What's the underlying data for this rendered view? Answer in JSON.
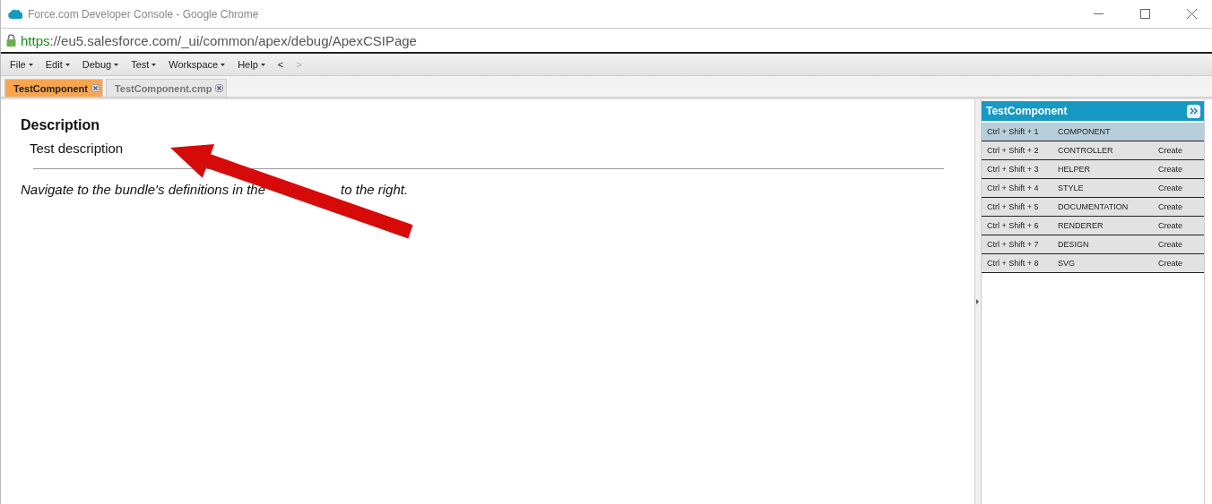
{
  "window": {
    "title": "Force.com Developer Console - Google Chrome"
  },
  "address_bar": {
    "url_scheme": "https",
    "url_rest": "://eu5.salesforce.com/_ui/common/apex/debug/ApexCSIPage"
  },
  "menu": [
    {
      "label": "File",
      "kind": "dropdown"
    },
    {
      "label": "Edit",
      "kind": "dropdown"
    },
    {
      "label": "Debug",
      "kind": "dropdown"
    },
    {
      "label": "Test",
      "kind": "dropdown"
    },
    {
      "label": "Workspace",
      "kind": "dropdown"
    },
    {
      "label": "Help",
      "kind": "dropdown"
    },
    {
      "label": "<",
      "kind": "nav",
      "disabled": false
    },
    {
      "label": ">",
      "kind": "nav",
      "disabled": true
    }
  ],
  "tabs": [
    {
      "label": "TestComponent",
      "selected": true
    },
    {
      "label": "TestComponent.cmp",
      "selected": false
    }
  ],
  "content": {
    "heading": "Description",
    "description": "Test description",
    "note_parts": [
      "Navigate to the bundle's definitions in the",
      "to the right."
    ]
  },
  "bundle_panel": {
    "title": "TestComponent",
    "rows": [
      {
        "shortcut": "Ctrl + Shift + 1",
        "name": "COMPONENT",
        "selected": true
      },
      {
        "shortcut": "Ctrl + Shift + 2",
        "name": "CONTROLLER",
        "action": "Create",
        "selected": false
      },
      {
        "shortcut": "Ctrl + Shift + 3",
        "name": "HELPER",
        "action": "Create",
        "selected": false
      },
      {
        "shortcut": "Ctrl + Shift + 4",
        "name": "STYLE",
        "action": "Create",
        "selected": false
      },
      {
        "shortcut": "Ctrl + Shift + 5",
        "name": "DOCUMENTATION",
        "action": "Create",
        "selected": false
      },
      {
        "shortcut": "Ctrl + Shift + 6",
        "name": "RENDERER",
        "action": "Create",
        "selected": false
      },
      {
        "shortcut": "Ctrl + Shift + 7",
        "name": "DESIGN",
        "action": "Create",
        "selected": false
      },
      {
        "shortcut": "Ctrl + Shift + 8",
        "name": "SVG",
        "action": "Create",
        "selected": false
      }
    ]
  }
}
